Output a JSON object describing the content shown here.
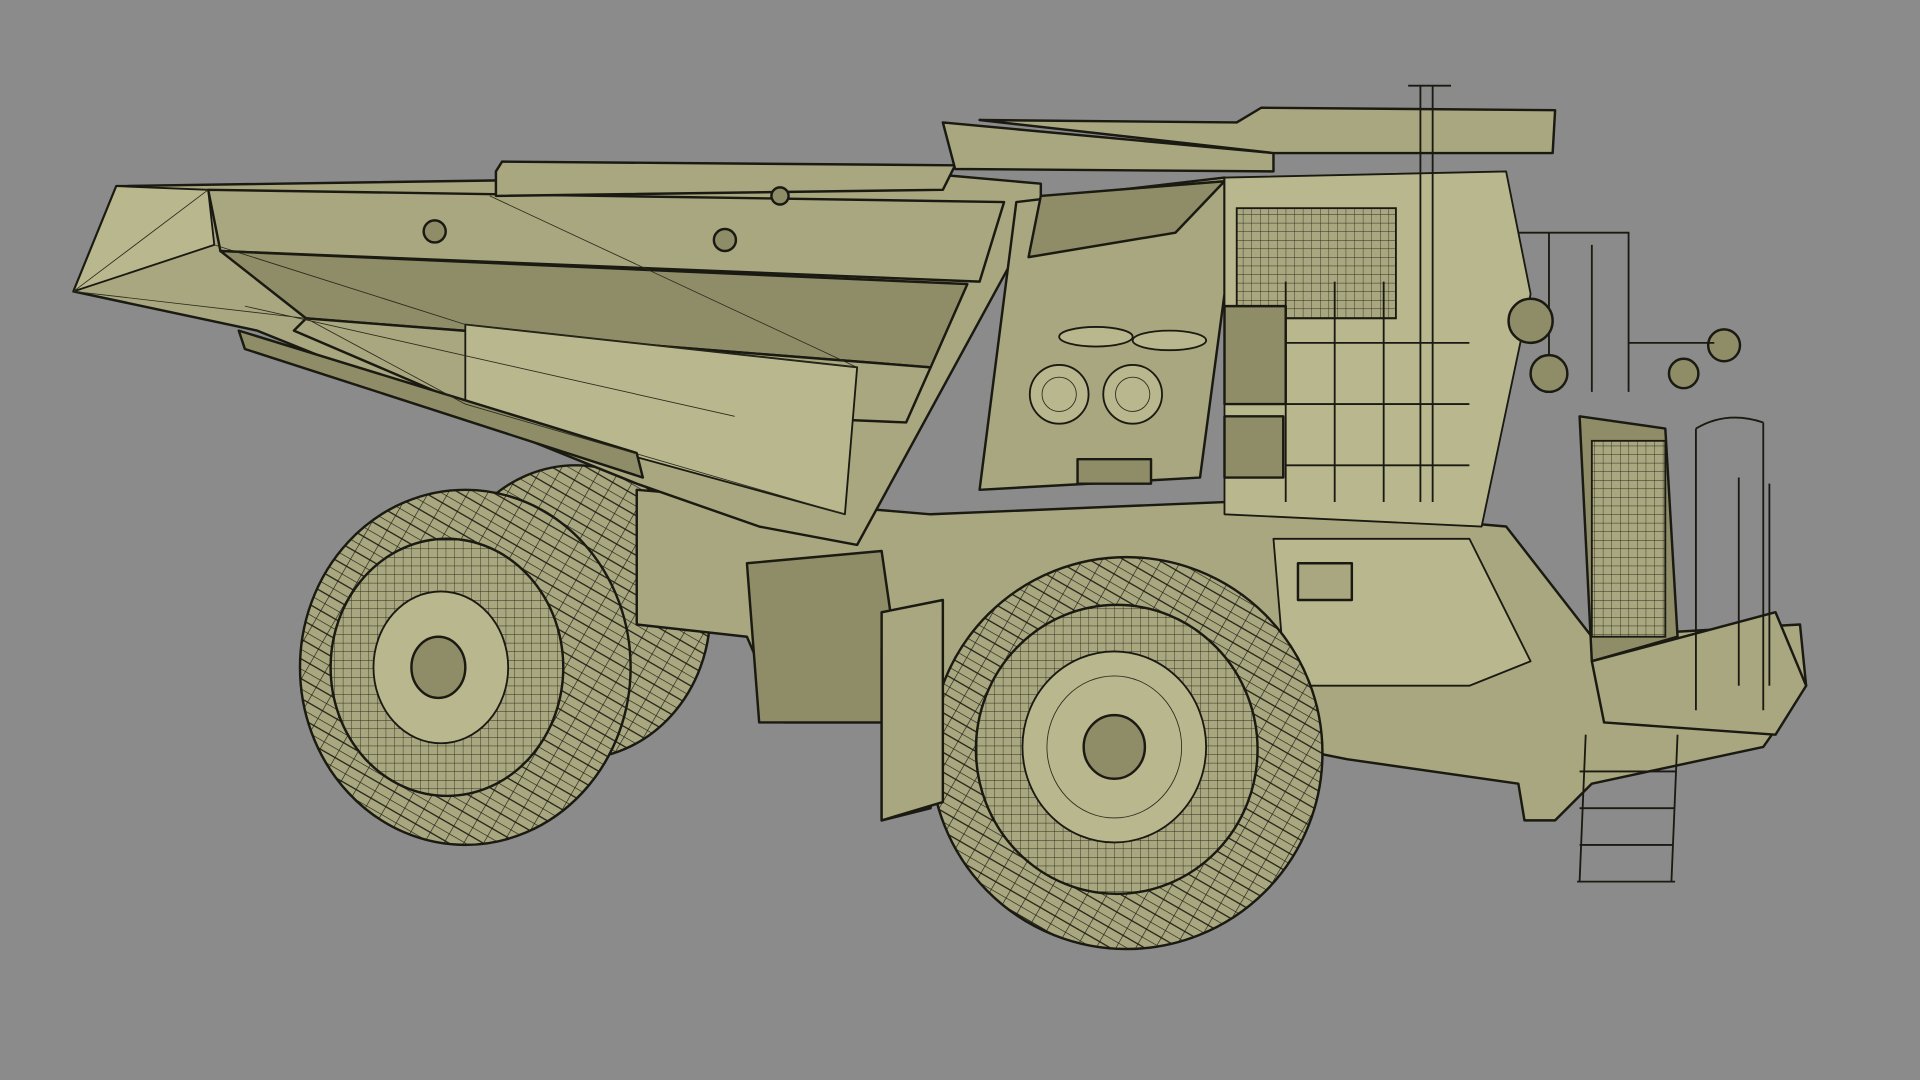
{
  "scene": {
    "subject": "mining-dump-truck-wireframe",
    "colors": {
      "background": "#8b8b8b",
      "body": "#a9a77f",
      "body_dark": "#8f8d68",
      "body_light": "#b9b78e",
      "wire": "#1a1a12"
    }
  }
}
